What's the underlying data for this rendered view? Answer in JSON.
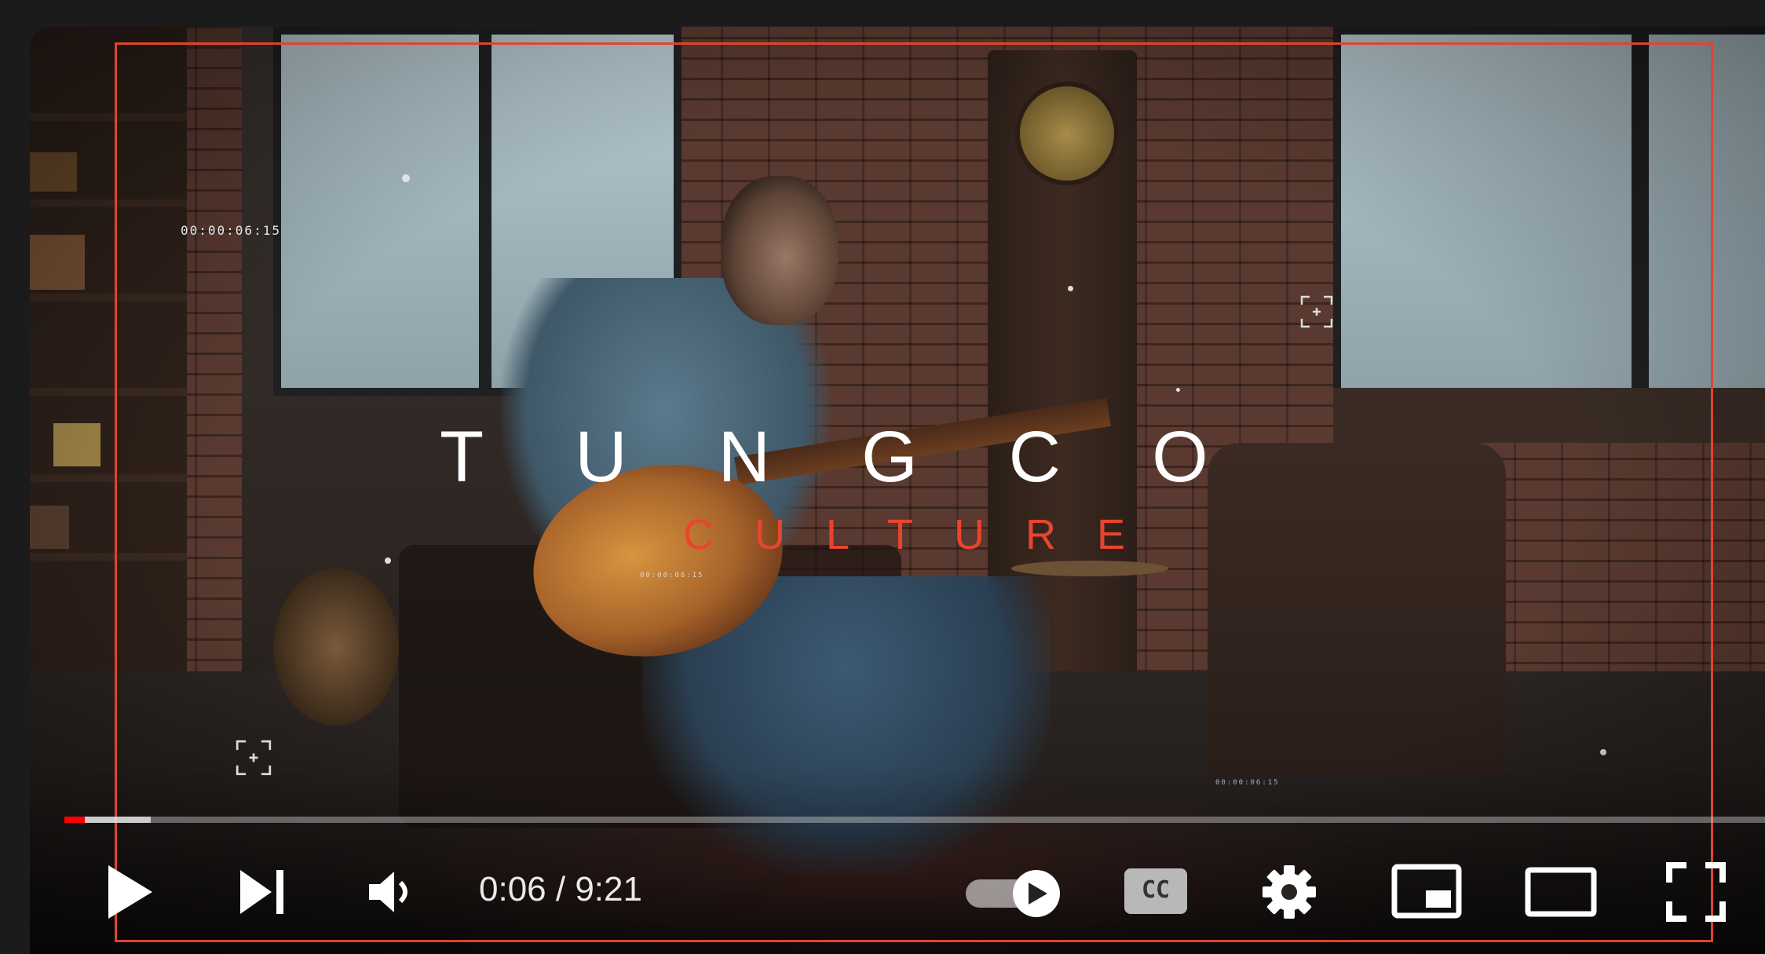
{
  "video": {
    "overlay_timecode_primary": "00:00:06:15",
    "overlay_timecode_secondary": "00:00:06:15",
    "overlay_timecode_small": "00:00:06:15",
    "brand_title": "TUNGCO",
    "brand_subtitle": "CULTURE"
  },
  "player": {
    "current_time": "0:06",
    "duration": "9:21",
    "time_separator": " / ",
    "progress_played_fraction": 0.0011,
    "progress_buffered_fraction": 0.0506,
    "autoplay_enabled": true,
    "captions_label": "CC"
  },
  "controls": {
    "play_icon": "play-icon",
    "next_icon": "next-track-icon",
    "volume_icon": "volume-icon",
    "autoplay_icon": "autoplay-toggle-icon",
    "captions_icon": "captions-icon",
    "settings_icon": "gear-icon",
    "miniplayer_icon": "miniplayer-icon",
    "theater_icon": "theater-mode-icon",
    "fullscreen_icon": "fullscreen-icon"
  },
  "colors": {
    "progress_played": "#ff0000",
    "frame_accent": "#e0442e",
    "subtitle_accent": "#e8452f"
  }
}
